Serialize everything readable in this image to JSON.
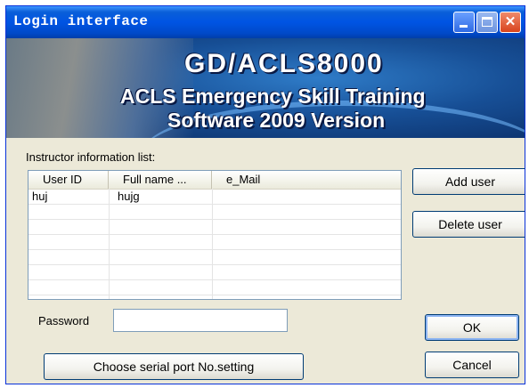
{
  "window": {
    "title": "Login interface"
  },
  "banner": {
    "line1": "GD/ACLS8000",
    "line2": "ACLS Emergency Skill Training",
    "line3": "Software 2009 Version"
  },
  "instructor_list": {
    "label": "Instructor information list:",
    "columns": [
      "User ID",
      "Full name ...",
      "e_Mail"
    ],
    "rows": [
      [
        "huj",
        "hujg",
        ""
      ]
    ]
  },
  "buttons": {
    "add_user": "Add user",
    "delete_user": "Delete user",
    "ok": "OK",
    "cancel": "Cancel",
    "serial_port": "Choose serial port No.setting"
  },
  "password": {
    "label": "Password",
    "value": ""
  }
}
